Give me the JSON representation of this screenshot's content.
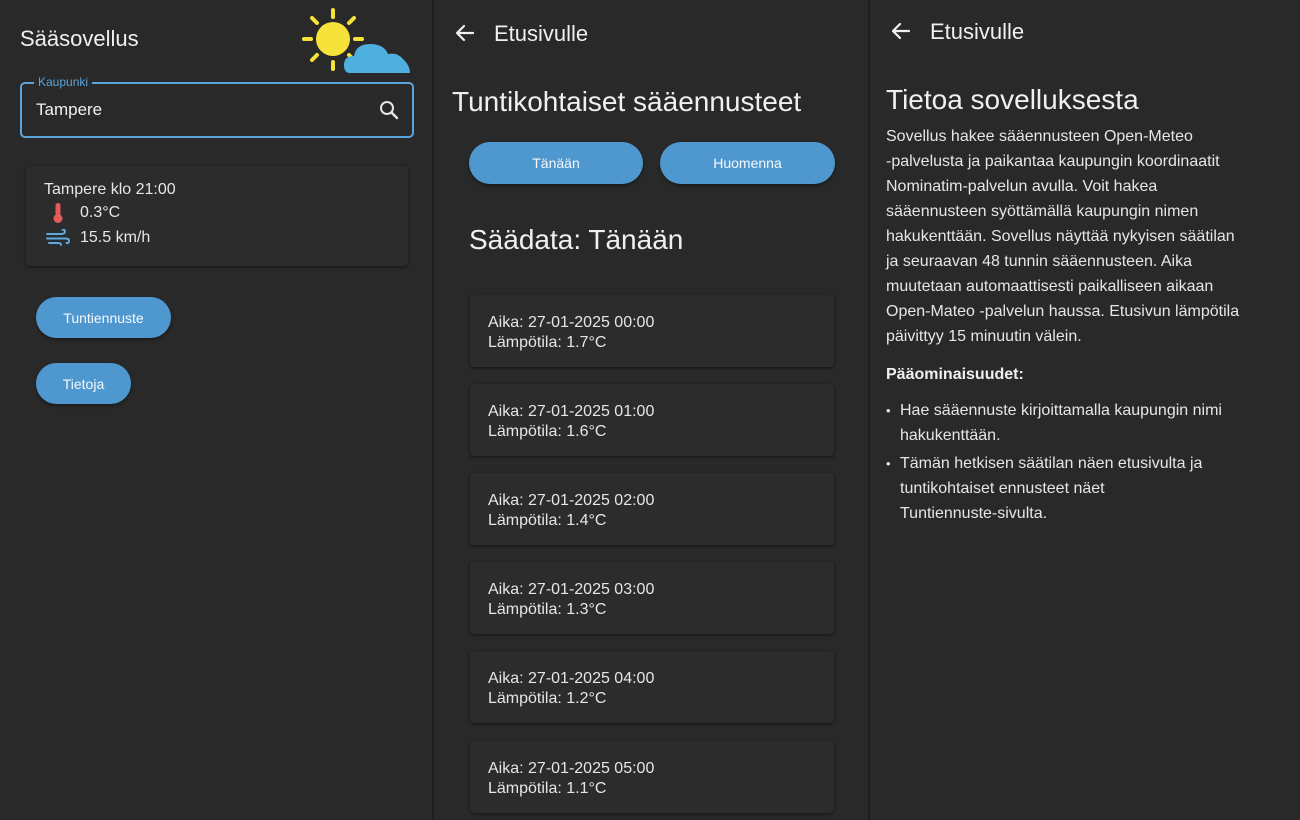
{
  "colors": {
    "background": "#292929",
    "card": "#2c2c2c",
    "accent": "#4f98cf",
    "field_border": "#5aa4dc",
    "sun": "#f7e23a",
    "cloud": "#4fb0e0",
    "thermometer": "#e35b5b",
    "wind": "#5ea9df"
  },
  "home": {
    "app_title": "Sääsovellus",
    "logo_icon": "sun-cloud-icon",
    "city_field": {
      "label": "Kaupunki",
      "value": "Tampere"
    },
    "search_icon": "search-icon",
    "weather_card": {
      "title": "Tampere klo 21:00",
      "temperature": "0.3°C",
      "temperature_icon": "thermometer-icon",
      "wind": "15.5 km/h",
      "wind_icon": "wind-icon"
    },
    "buttons": {
      "hourly": "Tuntiennuste",
      "about": "Tietoja"
    }
  },
  "hourly": {
    "back_label": "Etusivulle",
    "heading": "Tuntikohtaiset sääennusteet",
    "tabs": {
      "today": "Tänään",
      "tomorrow": "Huomenna"
    },
    "subheading": "Säädata: Tänään",
    "entries": [
      {
        "time": "Aika: 27-01-2025 00:00",
        "temp": "Lämpötila: 1.7°C"
      },
      {
        "time": "Aika: 27-01-2025 01:00",
        "temp": "Lämpötila: 1.6°C"
      },
      {
        "time": "Aika: 27-01-2025 02:00",
        "temp": "Lämpötila: 1.4°C"
      },
      {
        "time": "Aika: 27-01-2025 03:00",
        "temp": "Lämpötila: 1.3°C"
      },
      {
        "time": "Aika: 27-01-2025 04:00",
        "temp": "Lämpötila: 1.2°C"
      },
      {
        "time": "Aika: 27-01-2025 05:00",
        "temp": "Lämpötila: 1.1°C"
      }
    ]
  },
  "about": {
    "back_label": "Etusivulle",
    "heading": "Tietoa sovelluksesta",
    "paragraph_lines": [
      "Sovellus hakee sääennusteen Open-Meteo",
      "-palvelusta ja paikantaa kaupungin koordinaatit",
      "Nominatim-palvelun avulla. Voit hakea",
      "sääennusteen syöttämällä kaupungin nimen",
      "hakukenttään. Sovellus näyttää nykyisen säätilan",
      "ja seuraavan 48 tunnin sääennusteen. Aika",
      "muutetaan automaattisesti paikalliseen aikaan",
      "Open-Mateo -palvelun haussa. Etusivun lämpötila",
      "päivittyy 15 minuutin välein."
    ],
    "features_heading": "Pääominaisuudet:",
    "features": [
      {
        "line1": "Hae sääennuste kirjoittamalla kaupungin nimi",
        "line2": "hakukenttään."
      },
      {
        "line1": "Tämän hetkisen säätilan näen etusivulta ja",
        "line2": "tuntikohtaiset ennusteet näet",
        "line3": "Tuntiennuste-sivulta."
      }
    ],
    "bullet": "•"
  }
}
